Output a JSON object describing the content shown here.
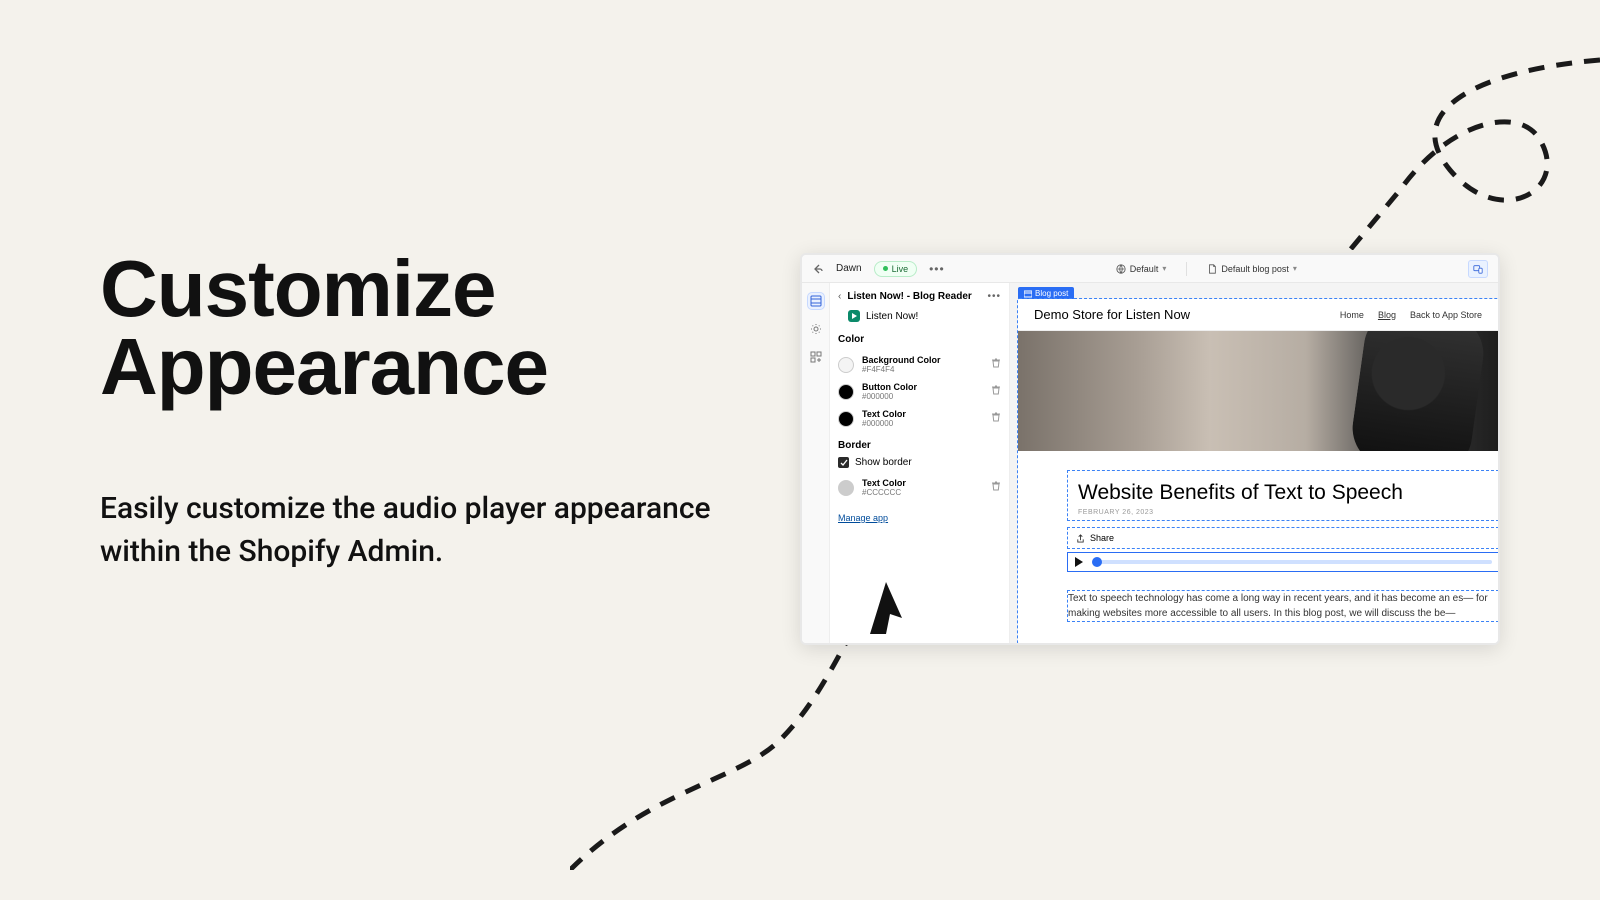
{
  "marketing": {
    "headline": "Customize Appearance",
    "body": "Easily customize the audio player appearance within the Shopify Admin."
  },
  "topbar": {
    "theme": "Dawn",
    "live": "Live",
    "viewport_label": "Default",
    "template_label": "Default blog post"
  },
  "breadcrumb": {
    "title": "Listen Now! - Blog Reader",
    "app": "Listen Now!"
  },
  "sections": {
    "color_title": "Color",
    "border_title": "Border",
    "show_border": "Show border",
    "manage": "Manage app",
    "colors": [
      {
        "label": "Background Color",
        "value": "#F4F4F4",
        "swatch": "#F4F4F4"
      },
      {
        "label": "Button Color",
        "value": "#000000",
        "swatch": "#000000"
      },
      {
        "label": "Text Color",
        "value": "#000000",
        "swatch": "#000000"
      }
    ],
    "border_color": {
      "label": "Text Color",
      "value": "#CCCCCC",
      "swatch": "#CCCCCC"
    }
  },
  "preview": {
    "blogpost_tag": "Blog post",
    "brand": "Demo Store for Listen Now",
    "nav": {
      "home": "Home",
      "blog": "Blog",
      "back": "Back to App Store"
    },
    "article_title": "Website Benefits of Text to Speech",
    "article_date": "FEBRUARY 26, 2023",
    "share": "Share",
    "body": "Text to speech technology has come a long way in recent years, and it has become an es— for making websites more accessible to all users. In this blog post, we will discuss the be—"
  }
}
